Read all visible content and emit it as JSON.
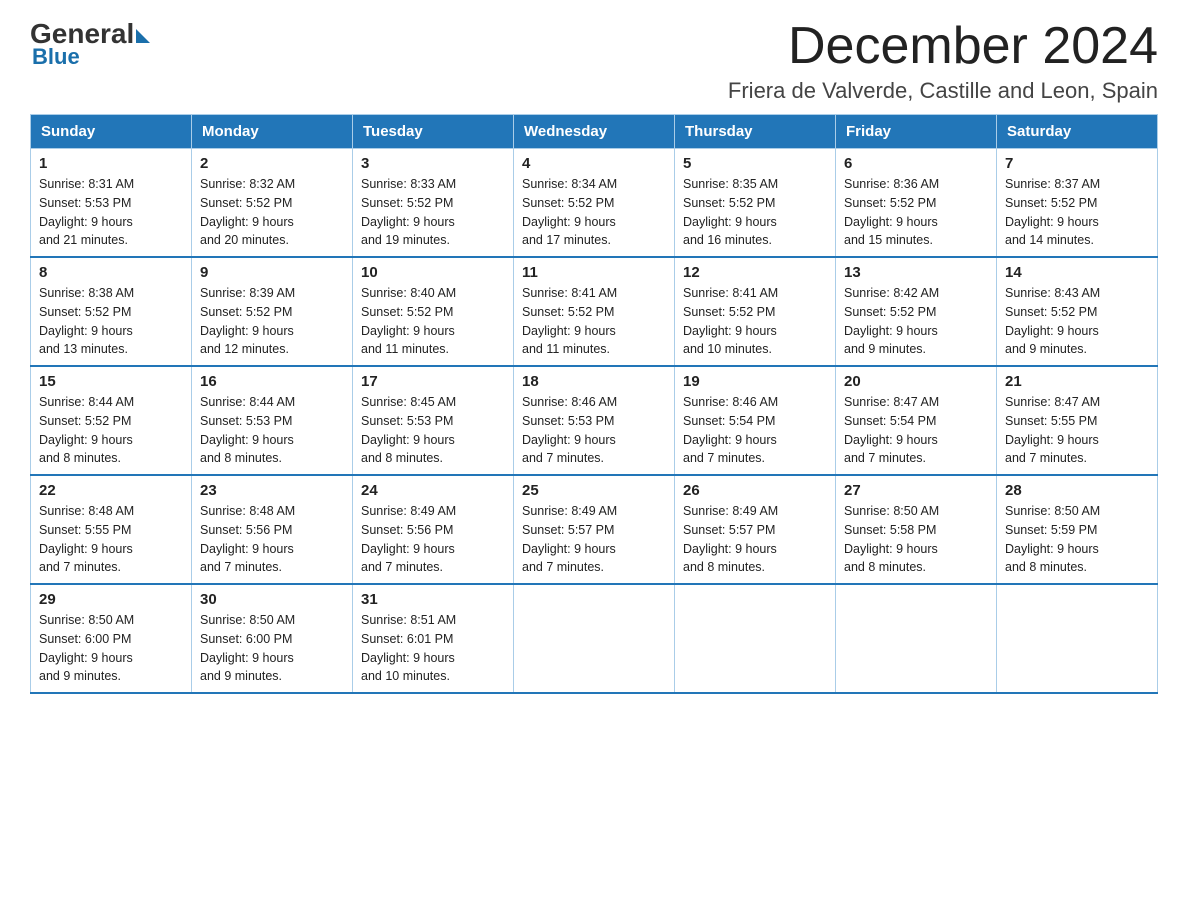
{
  "logo": {
    "general": "General",
    "blue": "Blue"
  },
  "title": "December 2024",
  "location": "Friera de Valverde, Castille and Leon, Spain",
  "weekdays": [
    "Sunday",
    "Monday",
    "Tuesday",
    "Wednesday",
    "Thursday",
    "Friday",
    "Saturday"
  ],
  "weeks": [
    [
      {
        "day": "1",
        "sunrise": "8:31 AM",
        "sunset": "5:53 PM",
        "daylight": "9 hours and 21 minutes."
      },
      {
        "day": "2",
        "sunrise": "8:32 AM",
        "sunset": "5:52 PM",
        "daylight": "9 hours and 20 minutes."
      },
      {
        "day": "3",
        "sunrise": "8:33 AM",
        "sunset": "5:52 PM",
        "daylight": "9 hours and 19 minutes."
      },
      {
        "day": "4",
        "sunrise": "8:34 AM",
        "sunset": "5:52 PM",
        "daylight": "9 hours and 17 minutes."
      },
      {
        "day": "5",
        "sunrise": "8:35 AM",
        "sunset": "5:52 PM",
        "daylight": "9 hours and 16 minutes."
      },
      {
        "day": "6",
        "sunrise": "8:36 AM",
        "sunset": "5:52 PM",
        "daylight": "9 hours and 15 minutes."
      },
      {
        "day": "7",
        "sunrise": "8:37 AM",
        "sunset": "5:52 PM",
        "daylight": "9 hours and 14 minutes."
      }
    ],
    [
      {
        "day": "8",
        "sunrise": "8:38 AM",
        "sunset": "5:52 PM",
        "daylight": "9 hours and 13 minutes."
      },
      {
        "day": "9",
        "sunrise": "8:39 AM",
        "sunset": "5:52 PM",
        "daylight": "9 hours and 12 minutes."
      },
      {
        "day": "10",
        "sunrise": "8:40 AM",
        "sunset": "5:52 PM",
        "daylight": "9 hours and 11 minutes."
      },
      {
        "day": "11",
        "sunrise": "8:41 AM",
        "sunset": "5:52 PM",
        "daylight": "9 hours and 11 minutes."
      },
      {
        "day": "12",
        "sunrise": "8:41 AM",
        "sunset": "5:52 PM",
        "daylight": "9 hours and 10 minutes."
      },
      {
        "day": "13",
        "sunrise": "8:42 AM",
        "sunset": "5:52 PM",
        "daylight": "9 hours and 9 minutes."
      },
      {
        "day": "14",
        "sunrise": "8:43 AM",
        "sunset": "5:52 PM",
        "daylight": "9 hours and 9 minutes."
      }
    ],
    [
      {
        "day": "15",
        "sunrise": "8:44 AM",
        "sunset": "5:52 PM",
        "daylight": "9 hours and 8 minutes."
      },
      {
        "day": "16",
        "sunrise": "8:44 AM",
        "sunset": "5:53 PM",
        "daylight": "9 hours and 8 minutes."
      },
      {
        "day": "17",
        "sunrise": "8:45 AM",
        "sunset": "5:53 PM",
        "daylight": "9 hours and 8 minutes."
      },
      {
        "day": "18",
        "sunrise": "8:46 AM",
        "sunset": "5:53 PM",
        "daylight": "9 hours and 7 minutes."
      },
      {
        "day": "19",
        "sunrise": "8:46 AM",
        "sunset": "5:54 PM",
        "daylight": "9 hours and 7 minutes."
      },
      {
        "day": "20",
        "sunrise": "8:47 AM",
        "sunset": "5:54 PM",
        "daylight": "9 hours and 7 minutes."
      },
      {
        "day": "21",
        "sunrise": "8:47 AM",
        "sunset": "5:55 PM",
        "daylight": "9 hours and 7 minutes."
      }
    ],
    [
      {
        "day": "22",
        "sunrise": "8:48 AM",
        "sunset": "5:55 PM",
        "daylight": "9 hours and 7 minutes."
      },
      {
        "day": "23",
        "sunrise": "8:48 AM",
        "sunset": "5:56 PM",
        "daylight": "9 hours and 7 minutes."
      },
      {
        "day": "24",
        "sunrise": "8:49 AM",
        "sunset": "5:56 PM",
        "daylight": "9 hours and 7 minutes."
      },
      {
        "day": "25",
        "sunrise": "8:49 AM",
        "sunset": "5:57 PM",
        "daylight": "9 hours and 7 minutes."
      },
      {
        "day": "26",
        "sunrise": "8:49 AM",
        "sunset": "5:57 PM",
        "daylight": "9 hours and 8 minutes."
      },
      {
        "day": "27",
        "sunrise": "8:50 AM",
        "sunset": "5:58 PM",
        "daylight": "9 hours and 8 minutes."
      },
      {
        "day": "28",
        "sunrise": "8:50 AM",
        "sunset": "5:59 PM",
        "daylight": "9 hours and 8 minutes."
      }
    ],
    [
      {
        "day": "29",
        "sunrise": "8:50 AM",
        "sunset": "6:00 PM",
        "daylight": "9 hours and 9 minutes."
      },
      {
        "day": "30",
        "sunrise": "8:50 AM",
        "sunset": "6:00 PM",
        "daylight": "9 hours and 9 minutes."
      },
      {
        "day": "31",
        "sunrise": "8:51 AM",
        "sunset": "6:01 PM",
        "daylight": "9 hours and 10 minutes."
      },
      null,
      null,
      null,
      null
    ]
  ]
}
